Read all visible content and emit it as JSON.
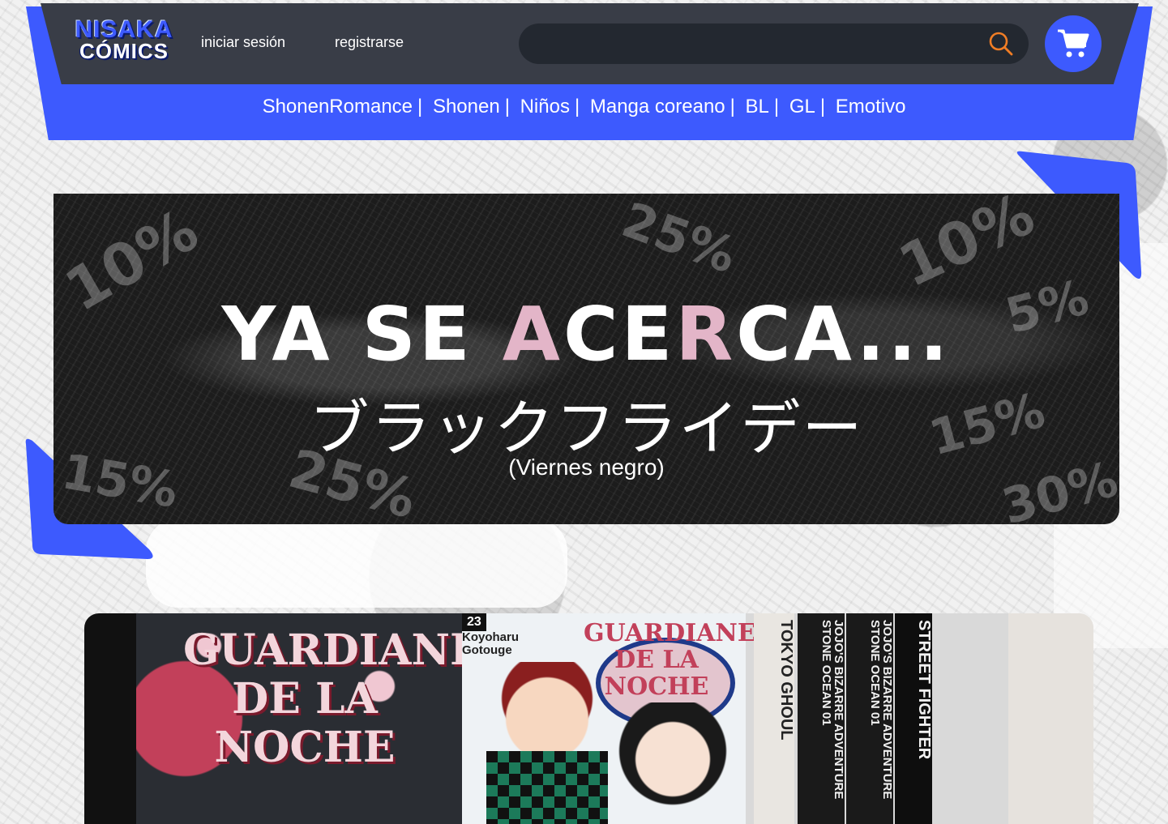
{
  "brand": {
    "logo_line1": "NISAKA",
    "logo_line2": "CÓMICS",
    "accent_color": "#3d5afe",
    "header_color": "#393d47"
  },
  "header": {
    "login_label": "iniciar sesión",
    "register_label": "registrarse",
    "search_value": "",
    "search_placeholder": "",
    "search_icon": "search-icon",
    "cart_icon": "shopping-cart-icon"
  },
  "categories": [
    {
      "label": "ShonenRomance"
    },
    {
      "label": "Shonen"
    },
    {
      "label": "Niños"
    },
    {
      "label": "Manga coreano"
    },
    {
      "label": "BL"
    },
    {
      "label": "GL"
    },
    {
      "label": "Emotivo"
    }
  ],
  "category_separator": "|",
  "banner": {
    "title_part1": "YA SE ",
    "title_pink": "A",
    "title_part2": "CE",
    "title_pink2": "R",
    "title_part3": "CA...",
    "title_japanese": "ブラックフライデー",
    "subtitle": "(Viernes negro)",
    "percent_labels": [
      "10%",
      "25%",
      "10%",
      "5%",
      "15%",
      "15%",
      "25%",
      "30%"
    ]
  },
  "photo": {
    "book1_title": "GUARDIANES DE LA NOCHE",
    "book2_volume": "23",
    "book2_author": "Koyoharu Gotouge",
    "book2_title": "GUARDIANES DE LA NOCHE",
    "spines": [
      {
        "text": "TOKYO GHOUL"
      },
      {
        "text": "JOJO'S BIZARRE ADVENTURE STONE OCEAN 01"
      },
      {
        "text": "JOJO'S BIZARRE ADVENTURE STONE OCEAN 01"
      },
      {
        "text": "STREET FIGHTER"
      }
    ]
  }
}
